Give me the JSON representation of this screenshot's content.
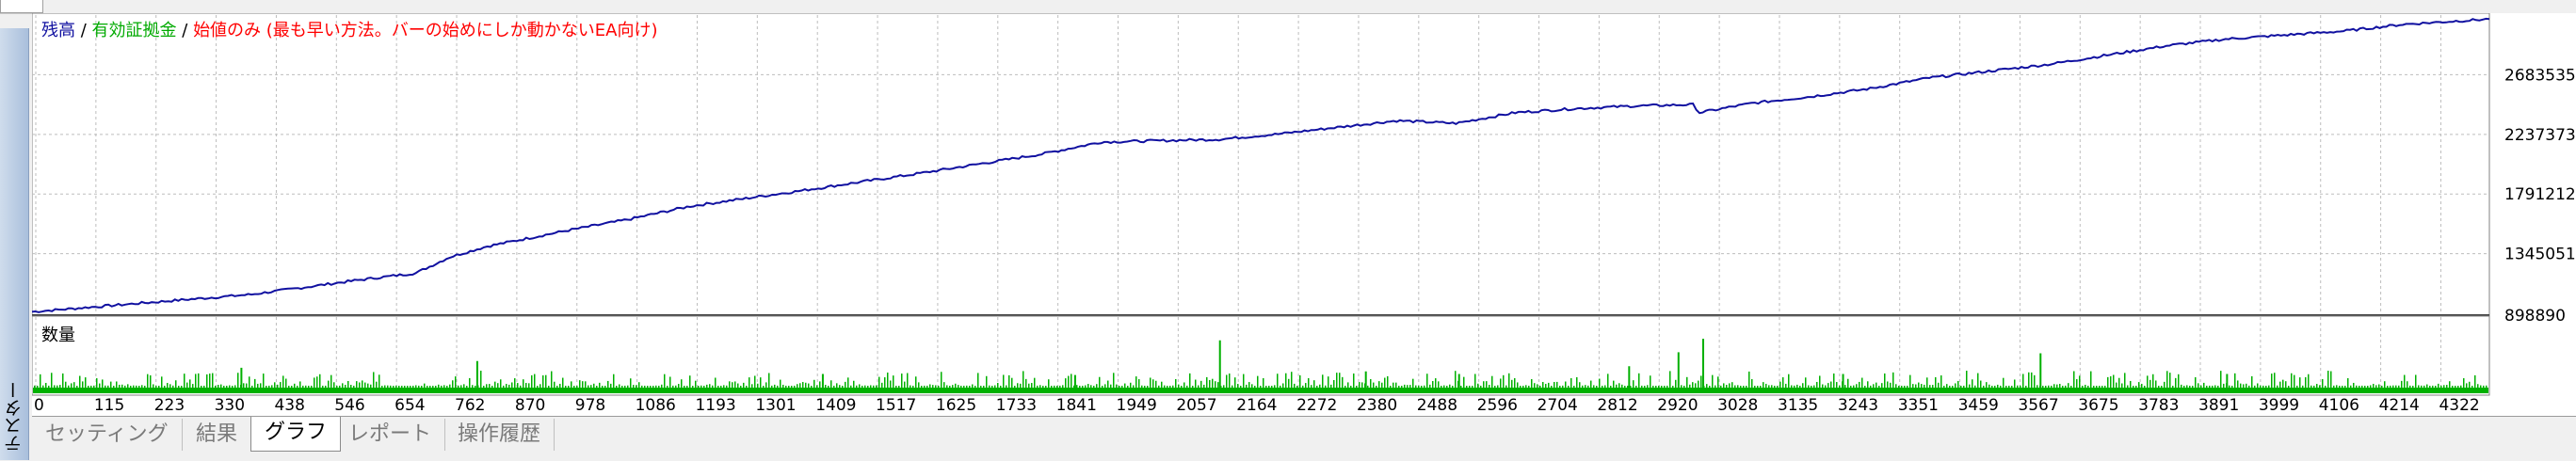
{
  "sidebar": {
    "label": "テスター"
  },
  "chart": {
    "legend": {
      "balance": "残高",
      "sep1": " / ",
      "equity": "有効証拠金",
      "sep2": " / ",
      "note": "始値のみ (最も早い方法。バーの始めにしか動かないEA向け)"
    },
    "volume_label": "数量",
    "colors": {
      "balance": "#1010a0",
      "equity": "#00aa00",
      "note": "#ff0000",
      "volume": "#00b000",
      "grid": "#bdbdbd"
    },
    "y_ticks": [
      "2683535",
      "2237373",
      "1791212",
      "1345051",
      "898890"
    ],
    "x_ticks": [
      "0",
      "115",
      "223",
      "330",
      "438",
      "546",
      "654",
      "762",
      "870",
      "978",
      "1086",
      "1193",
      "1301",
      "1409",
      "1517",
      "1625",
      "1733",
      "1841",
      "1949",
      "2057",
      "2164",
      "2272",
      "2380",
      "2488",
      "2596",
      "2704",
      "2812",
      "2920",
      "3028",
      "3135",
      "3243",
      "3351",
      "3459",
      "3567",
      "3675",
      "3783",
      "3891",
      "3999",
      "4106",
      "4214",
      "4322"
    ]
  },
  "chart_data": {
    "type": "line",
    "ylim": [
      898890,
      3130000
    ],
    "xlim": [
      0,
      4480
    ],
    "series": [
      {
        "name": "残高",
        "x": [
          0,
          200,
          400,
          600,
          700,
          762,
          830,
          978,
          1086,
          1200,
          1409,
          1625,
          1841,
          1949,
          2164,
          2272,
          2380,
          2488,
          2596,
          2704,
          2812,
          2920,
          3028,
          3040,
          3135,
          3243,
          3351,
          3459,
          3567,
          3675,
          3783,
          3891,
          3999,
          4106,
          4214,
          4322,
          4480
        ],
        "y": [
          910000,
          975000,
          1040000,
          1150000,
          1200000,
          1320000,
          1400000,
          1520000,
          1600000,
          1700000,
          1820000,
          1950000,
          2090000,
          2180000,
          2200000,
          2240000,
          2290000,
          2340000,
          2320000,
          2400000,
          2430000,
          2450000,
          2460000,
          2400000,
          2470000,
          2520000,
          2580000,
          2660000,
          2710000,
          2760000,
          2830000,
          2900000,
          2950000,
          2980000,
          3010000,
          3060000,
          3100000
        ]
      }
    ],
    "volume": {
      "name": "数量",
      "spikes": [
        {
          "x": 380,
          "v": 0.42
        },
        {
          "x": 810,
          "v": 0.55
        },
        {
          "x": 1440,
          "v": 0.3
        },
        {
          "x": 2164,
          "v": 0.95
        },
        {
          "x": 2430,
          "v": 0.35
        },
        {
          "x": 2910,
          "v": 0.45
        },
        {
          "x": 3000,
          "v": 0.72
        },
        {
          "x": 3045,
          "v": 0.98
        },
        {
          "x": 3660,
          "v": 0.7
        },
        {
          "x": 1900,
          "v": 0.28
        },
        {
          "x": 2600,
          "v": 0.3
        },
        {
          "x": 3300,
          "v": 0.3
        },
        {
          "x": 4000,
          "v": 0.3
        }
      ]
    }
  },
  "tabs": [
    {
      "label": "セッティング",
      "active": false
    },
    {
      "label": "結果",
      "active": false
    },
    {
      "label": "グラフ",
      "active": true
    },
    {
      "label": "レポート",
      "active": false
    },
    {
      "label": "操作履歴",
      "active": false
    }
  ]
}
